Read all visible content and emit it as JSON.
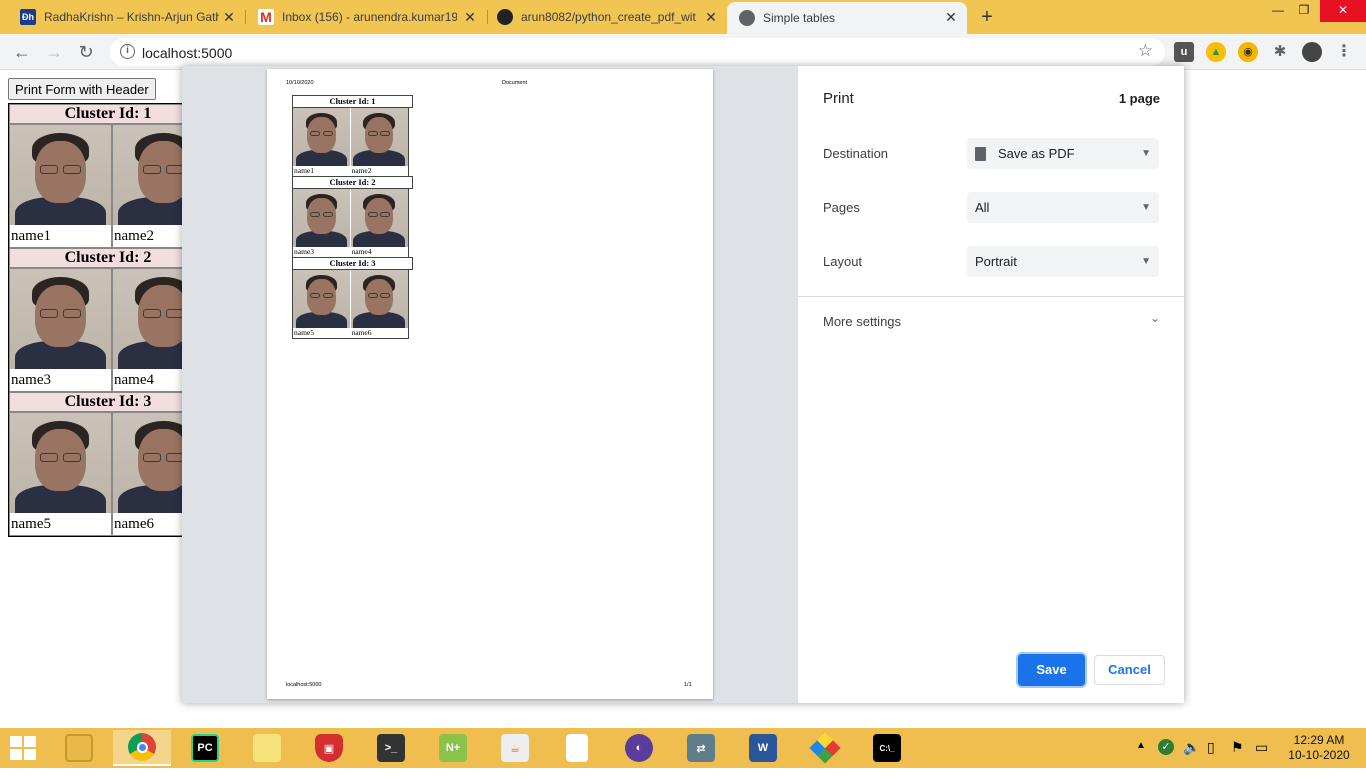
{
  "tabs": [
    {
      "title": "RadhaKrishn – Krishn-Arjun Gath",
      "favicon": "RH"
    },
    {
      "title": "Inbox (156) - arunendra.kumar19",
      "favicon": "M"
    },
    {
      "title": "arun8082/python_create_pdf_wit",
      "favicon": "GH"
    },
    {
      "title": "Simple tables",
      "favicon": "globe"
    }
  ],
  "toolbar": {
    "url": "localhost:5000"
  },
  "page": {
    "print_button": "Print Form with Header",
    "clusters": [
      {
        "header": "Cluster Id: 1",
        "names": [
          "name1",
          "name2"
        ]
      },
      {
        "header": "Cluster Id: 2",
        "names": [
          "name3",
          "name4"
        ]
      },
      {
        "header": "Cluster Id: 3",
        "names": [
          "name5",
          "name6"
        ]
      }
    ]
  },
  "preview": {
    "date": "10/10/2020",
    "doc_title": "Document",
    "footer_url": "localhost:5000",
    "page_num": "1/1"
  },
  "print_dialog": {
    "title": "Print",
    "page_count": "1 page",
    "destination_label": "Destination",
    "destination_value": "Save as PDF",
    "pages_label": "Pages",
    "pages_value": "All",
    "layout_label": "Layout",
    "layout_value": "Portrait",
    "more_settings": "More settings",
    "save": "Save",
    "cancel": "Cancel"
  },
  "taskbar": {
    "time": "12:29 AM",
    "date": "10-10-2020"
  },
  "colors": {
    "tab_strip": "#f1c552",
    "accent": "#1a73e8",
    "taskbar": "#f0be4e",
    "cluster_header": "#f2dede"
  }
}
